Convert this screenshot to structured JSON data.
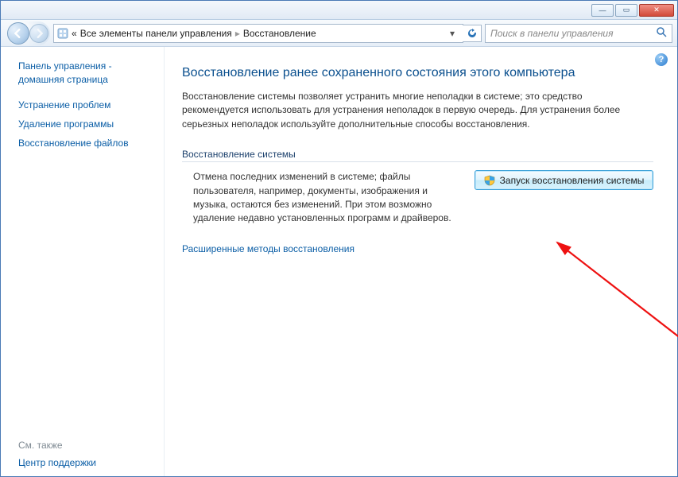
{
  "titlebar": {
    "minimize_glyph": "—",
    "maximize_glyph": "▭",
    "close_glyph": "✕"
  },
  "toolbar": {
    "breadcrumb_prefix": "«",
    "breadcrumb_1": "Все элементы панели управления",
    "breadcrumb_2": "Восстановление",
    "search_placeholder": "Поиск в панели управления"
  },
  "sidebar": {
    "home": "Панель управления - домашняя страница",
    "links": [
      "Устранение проблем",
      "Удаление программы",
      "Восстановление файлов"
    ],
    "also_header": "См. также",
    "also_link": "Центр поддержки"
  },
  "help": "?",
  "main": {
    "heading": "Восстановление ранее сохраненного состояния этого компьютера",
    "paragraph": "Восстановление системы позволяет устранить многие неполадки в системе; это средство рекомендуется использовать для устранения неполадок в первую очередь. Для устранения более серьезных неполадок используйте дополнительные способы восстановления.",
    "group_title": "Восстановление системы",
    "group_desc": "Отмена последних изменений в системе; файлы пользователя, например, документы, изображения и музыка, остаются без изменений. При этом возможно удаление недавно установленных программ и драйверов.",
    "button_label": "Запуск восстановления системы",
    "advanced_link": "Расширенные методы восстановления"
  }
}
